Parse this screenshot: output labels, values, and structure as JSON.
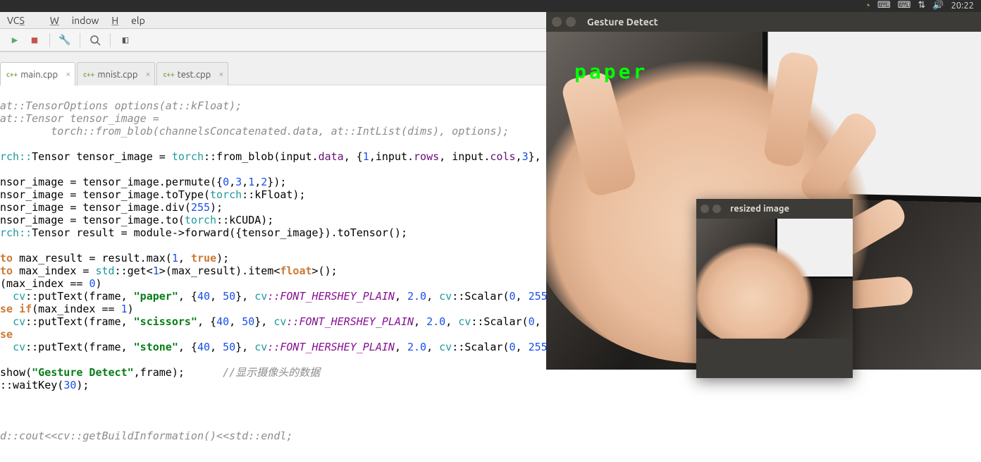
{
  "topbar": {
    "time": "20:22"
  },
  "menubar": {
    "vcs": "VCS",
    "window": "Window",
    "help": "Help"
  },
  "tabs": [
    {
      "label": "main.cpp",
      "active": true
    },
    {
      "label": "mnist.cpp",
      "active": false
    },
    {
      "label": "test.cpp",
      "active": false
    }
  ],
  "code": {
    "l1a": "at::TensorOptions options(at::kFloat);",
    "l2a": "at::Tensor tensor_image =",
    "l3a": "        torch::from_blob(channelsConcatenated.data, at::IntList(dims), options);",
    "l5_pre": "rch::",
    "l5_type": "Tensor",
    "l5_var": " tensor_image = ",
    "l5_torch": "torch",
    "l5_fn": "::from_blob(input.",
    "l5_data": "data",
    "l5_mid": ", {",
    "l5_n1": "1",
    "l5_c": ",input.",
    "l5_rows": "rows",
    "l5_c2": ", input.",
    "l5_cols": "cols",
    "l5_c3": ",",
    "l5_n3": "3",
    "l5_end": "}, ",
    "l7": "nsor_image = tensor_image.permute({",
    "l7_n": "0,3,1,2",
    "l7_e": "});",
    "l8": "nsor_image = tensor_image.toType(",
    "l8_t": "torch",
    "l8_k": "::kFloat);",
    "l9": "nsor_image = tensor_image.div(",
    "l9_n": "255",
    "l9_e": ");",
    "l10": "nsor_image = tensor_image.to(",
    "l10_t": "torch",
    "l10_k": "::kCUDA);",
    "l11_pre": "rch::",
    "l11_type": "Tensor",
    "l11_mid": " result = module->forward({tensor_image}).toTensor();",
    "l13_pre": "to",
    "l13_mid": " max_result = result.max(",
    "l13_n1": "1",
    "l13_c": ", ",
    "l13_true": "true",
    "l13_e": ");",
    "l14_pre": "to",
    "l14_mid": " max_index = ",
    "l14_std": "std",
    "l14_get": "::get<",
    "l14_n1": "1",
    "l14_mid2": ">(max_result).item<",
    "l14_float": "float",
    "l14_e": ">();",
    "l15": "(max_index == ",
    "l15_n": "0",
    "l15_e": ")",
    "l16_cv": "cv",
    "l16_fn": "::putText(frame, ",
    "l16_str": "\"paper\"",
    "l16_mid": ", {",
    "l16_n1": "40",
    "l16_c": ", ",
    "l16_n2": "50",
    "l16_mid2": "}, ",
    "l16_cv2": "cv",
    "l16_const": "::FONT_HERSHEY_PLAIN",
    "l16_mid3": ", ",
    "l16_n3": "2.0",
    "l16_mid4": ", ",
    "l16_cv3": "cv",
    "l16_sc": "::Scalar(",
    "l16_n4": "0",
    "l16_c2": ", ",
    "l16_n5": "255",
    "l17_pre": "se if",
    "l17_mid": "(max_index == ",
    "l17_n": "1",
    "l17_e": ")",
    "l18_str": "\"scissors\"",
    "l19_pre": "se",
    "l20_str": "\"stone\"",
    "l22_pre": "show(",
    "l22_str": "\"Gesture Detect\"",
    "l22_mid": ",frame);      ",
    "l22_cmt": "//显示摄像头的数据",
    "l23_pre": "::waitKey(",
    "l23_n": "30",
    "l23_e": ");",
    "l26": "d::cout<<cv::getBuildInformation()<<std::endl;"
  },
  "gesture": {
    "title": "Gesture Detect",
    "label": "paper"
  },
  "resized": {
    "title": "resized image"
  }
}
